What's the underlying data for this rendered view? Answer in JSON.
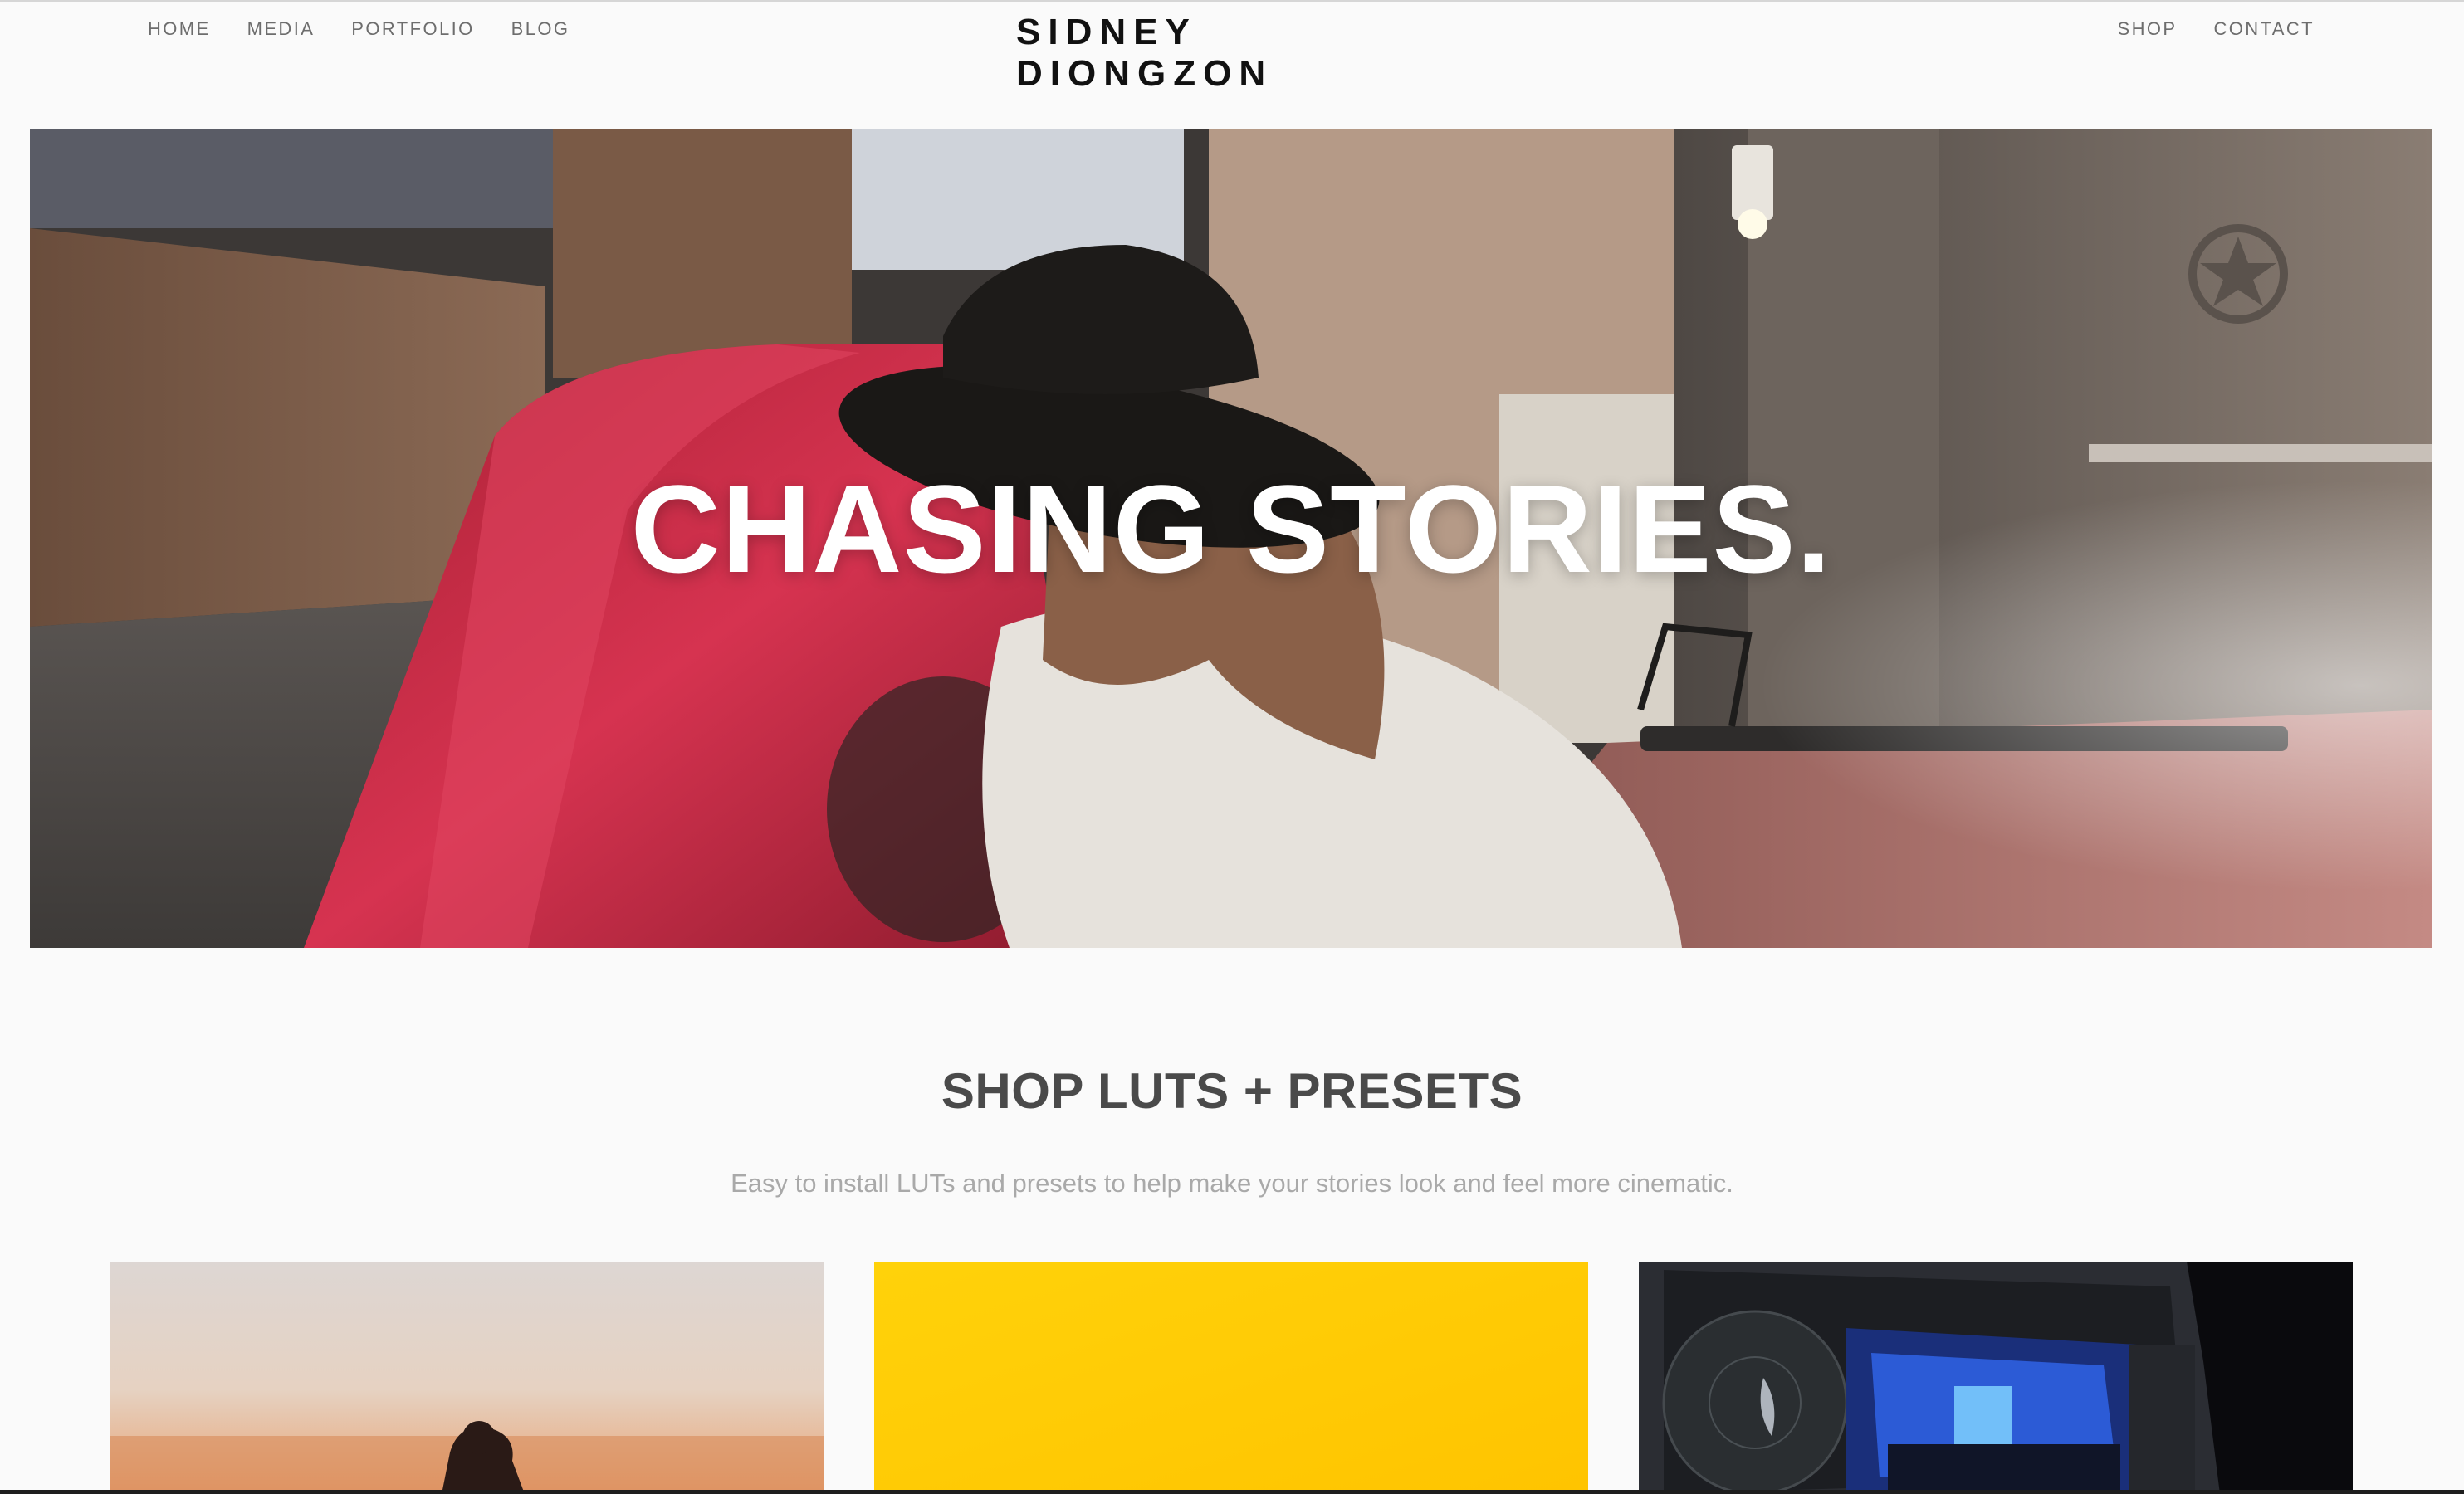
{
  "header": {
    "site_title": "SIDNEY DIONGZON",
    "nav_left": [
      {
        "label": "HOME"
      },
      {
        "label": "MEDIA"
      },
      {
        "label": "PORTFOLIO"
      },
      {
        "label": "BLOG"
      }
    ],
    "nav_right": [
      {
        "label": "SHOP"
      },
      {
        "label": "CONTACT"
      }
    ]
  },
  "hero": {
    "heading": "CHASING STORIES."
  },
  "shop": {
    "heading": "SHOP LUTS + PRESETS",
    "subheading": "Easy to install LUTs and presets to help make your stories look and feel more cinematic.",
    "cards": [
      {
        "image": "sunset-silhouette-photo"
      },
      {
        "image": "yellow-backdrop-photo"
      },
      {
        "image": "color-grading-monitor-photo"
      }
    ]
  },
  "colors": {
    "background": "#fafafa",
    "title": "#111111",
    "nav": "#6d6d6d",
    "heading": "#4a4a4a",
    "subtext": "#a9a9a9",
    "accent_yellow": "#ffc800",
    "car_red": "#c0283c"
  }
}
